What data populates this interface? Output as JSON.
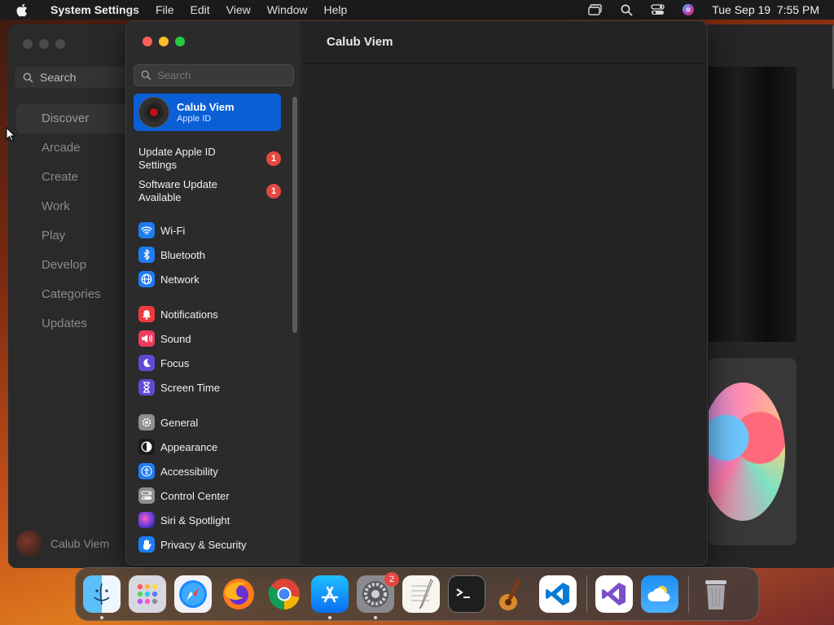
{
  "menubar": {
    "app_name": "System Settings",
    "menus": [
      "File",
      "Edit",
      "View",
      "Window",
      "Help"
    ],
    "datetime": "Tue Sep 19  7:55 PM"
  },
  "background_window": {
    "search_label": "Search",
    "nav": [
      "Discover",
      "Arcade",
      "Create",
      "Work",
      "Play",
      "Develop",
      "Categories",
      "Updates"
    ],
    "active_nav": "Discover",
    "user_name": "Calub Viem"
  },
  "settings": {
    "search_placeholder": "Search",
    "apple_id": {
      "name": "Calub Viem",
      "subtitle": "Apple ID"
    },
    "notices": [
      {
        "label": "Update Apple ID Settings",
        "badge": "1"
      },
      {
        "label": "Software Update Available",
        "badge": "1"
      }
    ],
    "groups": [
      [
        {
          "label": "Wi-Fi",
          "icon": "wifi-icon",
          "color": "#1e7cf2"
        },
        {
          "label": "Bluetooth",
          "icon": "bluetooth-icon",
          "color": "#1e7cf2"
        },
        {
          "label": "Network",
          "icon": "globe-icon",
          "color": "#1e7cf2"
        }
      ],
      [
        {
          "label": "Notifications",
          "icon": "bell-icon",
          "color": "#ef3b3f"
        },
        {
          "label": "Sound",
          "icon": "speaker-icon",
          "color": "#ef3b5c"
        },
        {
          "label": "Focus",
          "icon": "moon-icon",
          "color": "#5d4bd6"
        },
        {
          "label": "Screen Time",
          "icon": "hourglass-icon",
          "color": "#5d4bd6"
        }
      ],
      [
        {
          "label": "General",
          "icon": "gear-icon",
          "color": "#8e8e93"
        },
        {
          "label": "Appearance",
          "icon": "appearance-icon",
          "color": "#1c1c1c"
        },
        {
          "label": "Accessibility",
          "icon": "accessibility-icon",
          "color": "#1e7cf2"
        },
        {
          "label": "Control Center",
          "icon": "control-center-icon",
          "color": "#8e8e93"
        },
        {
          "label": "Siri & Spotlight",
          "icon": "siri-icon",
          "color": "#a33fd6"
        },
        {
          "label": "Privacy & Security",
          "icon": "hand-icon",
          "color": "#1e7cf2"
        }
      ]
    ],
    "pane_title": "Calub Viem"
  },
  "dock": {
    "apps": [
      {
        "name": "finder-icon",
        "running": true
      },
      {
        "name": "launchpad-icon",
        "running": false
      },
      {
        "name": "safari-icon",
        "running": false
      },
      {
        "name": "firefox-icon",
        "running": false
      },
      {
        "name": "chrome-icon",
        "running": false
      },
      {
        "name": "app-store-icon",
        "running": true
      },
      {
        "name": "system-settings-icon",
        "running": true,
        "badge": "2"
      },
      {
        "name": "textedit-icon",
        "running": false
      },
      {
        "name": "terminal-icon",
        "running": false
      },
      {
        "name": "garageband-icon",
        "running": false
      },
      {
        "name": "vscode-icon",
        "running": false
      },
      {
        "name": "visual-studio-icon",
        "running": false
      },
      {
        "name": "weather-icon",
        "running": false
      },
      {
        "name": "trash-icon",
        "running": false
      }
    ],
    "system_settings_badge": "2"
  }
}
